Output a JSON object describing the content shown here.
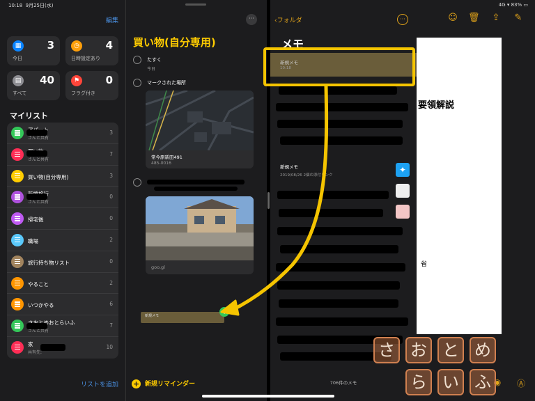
{
  "statusbar": {
    "time": "10:18",
    "date": "9月25日(水)",
    "right": "4G ▾ 83% ▭"
  },
  "sidebar": {
    "edit": "編集",
    "cards": [
      {
        "label": "今日",
        "count": "3",
        "color": "#0a84ff",
        "icon": "calendar-icon"
      },
      {
        "label": "日時設定あり",
        "count": "4",
        "color": "#ff9f0a",
        "icon": "clock-icon"
      },
      {
        "label": "すべて",
        "count": "40",
        "color": "#8e8e93",
        "icon": "tray-icon"
      },
      {
        "label": "フラグ付き",
        "count": "0",
        "color": "#ff453a",
        "icon": "flag-icon"
      }
    ],
    "mylists_heading": "マイリスト",
    "lists": [
      {
        "name": "アパート",
        "sub": "さんと共有",
        "count": "3",
        "color": "#34c759"
      },
      {
        "name": "買い物",
        "sub": "さんと共有",
        "count": "7",
        "color": "#ff2d55"
      },
      {
        "name": "買い物(自分専用)",
        "sub": "",
        "count": "3",
        "color": "#ffcc00"
      },
      {
        "name": "新婚旅行",
        "sub": "さんと共有",
        "count": "0",
        "color": "#af52de"
      },
      {
        "name": "帰宅後",
        "sub": "",
        "count": "0",
        "color": "#bf5af2"
      },
      {
        "name": "職場",
        "sub": "",
        "count": "2",
        "color": "#5ac8fa"
      },
      {
        "name": "旅行持ち物リスト",
        "sub": "",
        "count": "0",
        "color": "#a2845e"
      },
      {
        "name": "やること",
        "sub": "",
        "count": "2",
        "color": "#ff9500"
      },
      {
        "name": "いつかやる",
        "sub": "",
        "count": "6",
        "color": "#ff9500"
      },
      {
        "name": "さおとめおとらいふ",
        "sub": "さんと共有",
        "count": "7",
        "color": "#34c759"
      },
      {
        "name": "家",
        "sub": "共有先:",
        "count": "10",
        "color": "#ff2d55"
      }
    ],
    "add_list": "リストを追加"
  },
  "reminders": {
    "more": "···",
    "title": "買い物(自分専用)",
    "items": [
      {
        "text": "たすく",
        "sub": "今日"
      },
      {
        "text": "マークされた場所",
        "sub": ""
      }
    ],
    "map": {
      "caption": "常今原新田491",
      "sub": "485-0016"
    },
    "photo_caption": "goo.gl",
    "drag_chip": "新規メモ",
    "new_reminder": "新規リマインダー"
  },
  "notes": {
    "back": "フォルダ",
    "title": "メモ",
    "highlighted": {
      "title": "新規メモ",
      "date": "10:18"
    },
    "second": {
      "title": "新規メモ",
      "date": "2019/08/26   2個の添付リンク"
    },
    "count": "706件のメモ"
  },
  "detail": {
    "heading": "要領解説",
    "small": "省"
  },
  "watermark": [
    "さ",
    "お",
    "と",
    "め",
    "ら",
    "い",
    "ふ"
  ],
  "colors": {
    "accent_yellow": "#ffcc00",
    "notes_accent": "#e0a31a",
    "annotation": "#f5c400"
  }
}
